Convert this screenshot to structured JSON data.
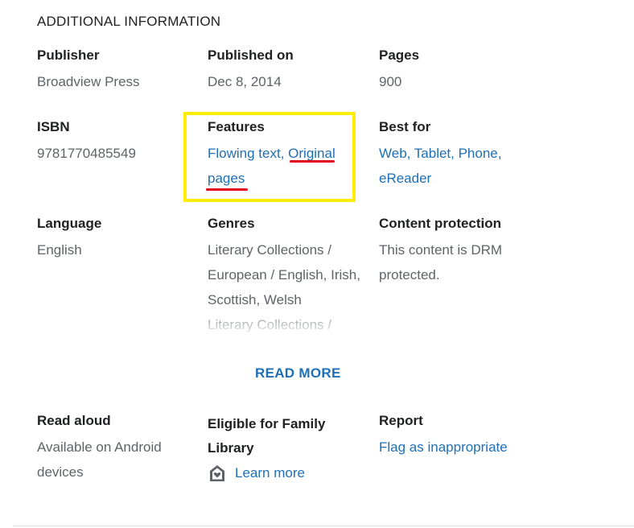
{
  "section": {
    "title": "ADDITIONAL INFORMATION"
  },
  "publisher": {
    "label": "Publisher",
    "value": "Broadview Press"
  },
  "published_on": {
    "label": "Published on",
    "value": "Dec 8, 2014"
  },
  "pages": {
    "label": "Pages",
    "value": "900"
  },
  "isbn": {
    "label": "ISBN",
    "value": "9781770485549"
  },
  "features": {
    "label": "Features",
    "item1": "Flowing text",
    "separator": ", ",
    "item2_line1": "Original",
    "item2_line2": "pages"
  },
  "best_for": {
    "label": "Best for",
    "line1": "Web, Tablet, Phone,",
    "line2": "eReader"
  },
  "language": {
    "label": "Language",
    "value": "English"
  },
  "genres": {
    "label": "Genres",
    "lines": [
      "Literary Collections /",
      "European / English, Irish,",
      "Scottish, Welsh",
      "Literary Collections /"
    ]
  },
  "content_protection": {
    "label": "Content protection",
    "line1": "This content is DRM",
    "line2": "protected."
  },
  "read_more": {
    "label": "READ MORE"
  },
  "read_aloud": {
    "label": "Read aloud",
    "line1": "Available on Android",
    "line2": "devices"
  },
  "family_library": {
    "label_line1": "Eligible for Family",
    "label_line2": "Library",
    "link": "Learn more",
    "icon": "family-library-icon"
  },
  "report": {
    "label": "Report",
    "link": "Flag as inappropriate"
  },
  "colors": {
    "link": "#1f6fb6",
    "highlight": "#ffee00",
    "underline": "#e2001a",
    "label": "#202124",
    "value": "#5f6368"
  }
}
